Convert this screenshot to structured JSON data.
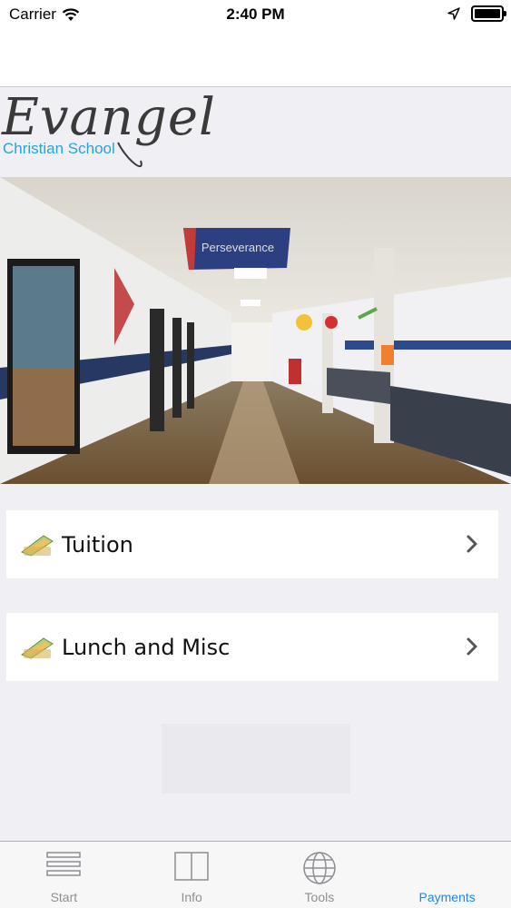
{
  "status_bar": {
    "carrier": "Carrier",
    "time": "2:40 PM"
  },
  "logo": {
    "title": "Evangel",
    "subtitle": "Christian School"
  },
  "hero": {
    "banner_text": "Perseverance"
  },
  "menu": {
    "items": [
      {
        "label": "Tuition",
        "icon": "payment-card-icon"
      },
      {
        "label": "Lunch and Misc",
        "icon": "payment-card-icon"
      }
    ]
  },
  "tab_bar": {
    "tabs": [
      {
        "label": "Start",
        "icon": "list-icon",
        "active": false
      },
      {
        "label": "Info",
        "icon": "book-icon",
        "active": false
      },
      {
        "label": "Tools",
        "icon": "globe-icon",
        "active": false
      },
      {
        "label": "Payments",
        "icon": "payments-icon",
        "active": true
      }
    ],
    "inactive_color": "#8e8e93",
    "active_color": "#1e88e5"
  }
}
